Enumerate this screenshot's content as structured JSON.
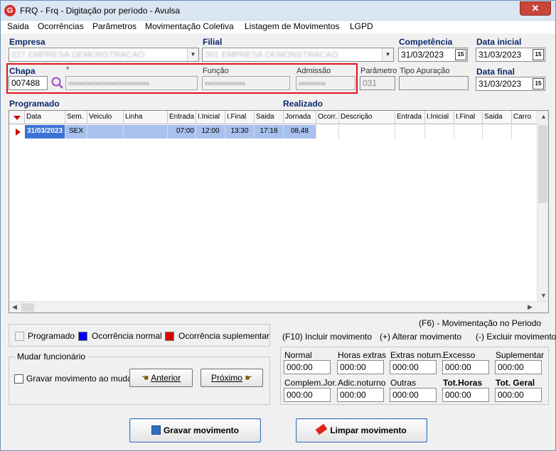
{
  "window": {
    "title": "FRQ - Frq - Digitação por período - Avulsa",
    "close_label": "✕"
  },
  "menu": {
    "items": [
      {
        "label": "Saida"
      },
      {
        "label": "Ocorrências"
      },
      {
        "label": "Parâmetros"
      },
      {
        "label": "Movimentação Coletiva"
      },
      {
        "label": "Listagem de Movimentos"
      },
      {
        "label": "LGPD"
      }
    ]
  },
  "form": {
    "empresa_label": "Empresa",
    "empresa_value": "027 EMPRESA DEMONSTRACAO",
    "filial_label": "Filial",
    "filial_value": "001 EMPRESA DEMONSTRACAO",
    "competencia_label": "Competência",
    "competencia_value": "31/03/2023",
    "data_inicial_label": "Data inicial",
    "data_inicial_value": "31/03/2023",
    "data_final_label": "Data final",
    "data_final_value": "31/03/2023",
    "chapa_label": "Chapa",
    "chapa_value": "007488",
    "nome_label": "*",
    "nome_value": "xxxxxxxxxxxxxxxxxxxxxxxxxxxxxx",
    "funcao_label": "Função",
    "funcao_value": "xxxxxxxxxxxxxxx",
    "admissao_label": "Admissão",
    "admissao_value": "xxxxxxxxxx",
    "parametro_label": "Parâmetro",
    "parametro_value": "031",
    "tipo_apuracao_label": "Tipo Apuração",
    "tipo_apuracao_value": "",
    "cal_icon": "15"
  },
  "grid": {
    "programado_label": "Programado",
    "realizado_label": "Realizado",
    "columns": [
      "Data",
      "Sem.",
      "Veiculo",
      "Linha",
      "Entrada",
      "I.Inicial",
      "I.Final",
      "Saida",
      "Jornada",
      "Ocorr.",
      "Descrição",
      "Entrada",
      "I.Inicial",
      "I.Final",
      "Saida",
      "Carro"
    ],
    "row": [
      "31/03/2023",
      "SEX",
      "",
      "",
      "07:00",
      "12:00",
      "13:30",
      "17:18",
      "08,48",
      "",
      "",
      "",
      "",
      "",
      "",
      ""
    ]
  },
  "legend": {
    "programado": "Programado",
    "ocorrencia_normal": "Ocorrência normal",
    "ocorrencia_suplementar": "Ocorrência suplementar",
    "colors": {
      "programado": "#f0f0f0",
      "normal": "#0000ee",
      "suplementar": "#e00000"
    }
  },
  "mudar": {
    "group_label": "Mudar funcionário",
    "gravar_label": "Gravar movimento ao mudar",
    "anterior_label": "Anterior",
    "proximo_label": "Próximo"
  },
  "shortcuts": {
    "f6": "(F6) - Movimentação no Periodo",
    "f10": "(F10) Incluir movimento",
    "alterar": "(+) Alterar movimento",
    "excluir": "(-) Excluir movimento"
  },
  "totals": {
    "normal_label": "Normal",
    "normal_value": "000:00",
    "horas_extras_label": "Horas extras",
    "horas_extras_value": "000:00",
    "extras_noturn_label": "Extras noturn.",
    "extras_noturn_value": "000:00",
    "excesso_label": "Excesso",
    "excesso_value": "000:00",
    "suplementar_label": "Suplementar",
    "suplementar_value": "000:00",
    "complem_label": "Complem.Jor.",
    "complem_value": "000:00",
    "adic_label": "Adic.noturno",
    "adic_value": "000:00",
    "outras_label": "Outras",
    "outras_value": "000:00",
    "tot_horas_label": "Tot.Horas",
    "tot_horas_value": "000:00",
    "tot_geral_label": "Tot. Geral",
    "tot_geral_value": "000:00"
  },
  "actions": {
    "gravar_label": "Gravar movimento",
    "limpar_label": "Limpar movimento"
  }
}
